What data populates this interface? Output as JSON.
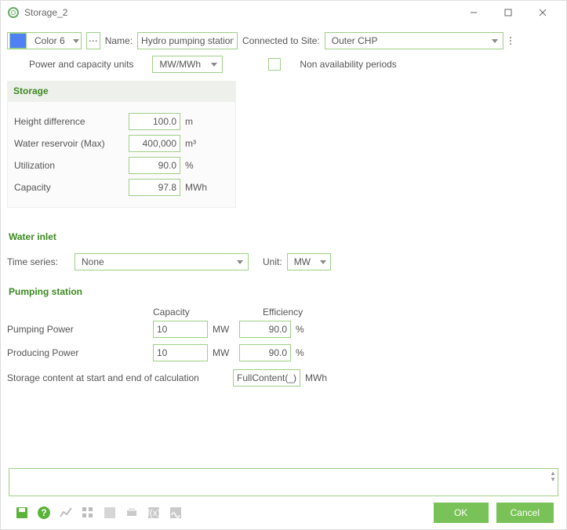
{
  "window": {
    "title": "Storage_2"
  },
  "header": {
    "color_label": "Color 6",
    "name_label": "Name:",
    "name_value": "Hydro pumping station",
    "connected_label": "Connected to Site:",
    "connected_value": "Outer CHP"
  },
  "units_row": {
    "label": "Power and capacity units",
    "value": "MW/MWh",
    "nonavail_label": "Non availability periods"
  },
  "storage": {
    "title": "Storage",
    "rows": {
      "height_diff": {
        "label": "Height difference",
        "value": "100.0",
        "unit": "m"
      },
      "reservoir": {
        "label": "Water reservoir (Max)",
        "value": "400,000",
        "unit": "m³"
      },
      "utilization": {
        "label": "Utilization",
        "value": "90.0",
        "unit": "%"
      },
      "capacity": {
        "label": "Capacity",
        "value": "97.8",
        "unit": "MWh"
      }
    }
  },
  "water_inlet": {
    "title": "Water inlet",
    "time_series_label": "Time series:",
    "time_series_value": "None",
    "unit_label": "Unit:",
    "unit_value": "MW"
  },
  "pumping": {
    "title": "Pumping station",
    "col_capacity": "Capacity",
    "col_efficiency": "Efficiency",
    "rows": {
      "pumping": {
        "label": "Pumping Power",
        "cap": "10",
        "cap_unit": "MW",
        "eff": "90.0",
        "eff_unit": "%"
      },
      "producing": {
        "label": "Producing Power",
        "cap": "10",
        "cap_unit": "MW",
        "eff": "90.0",
        "eff_unit": "%"
      }
    },
    "storage_content_label": "Storage content at start and end of calculation",
    "storage_content_value": "FullContent(_)",
    "storage_content_unit": "MWh"
  },
  "footer": {
    "ok": "OK",
    "cancel": "Cancel"
  }
}
